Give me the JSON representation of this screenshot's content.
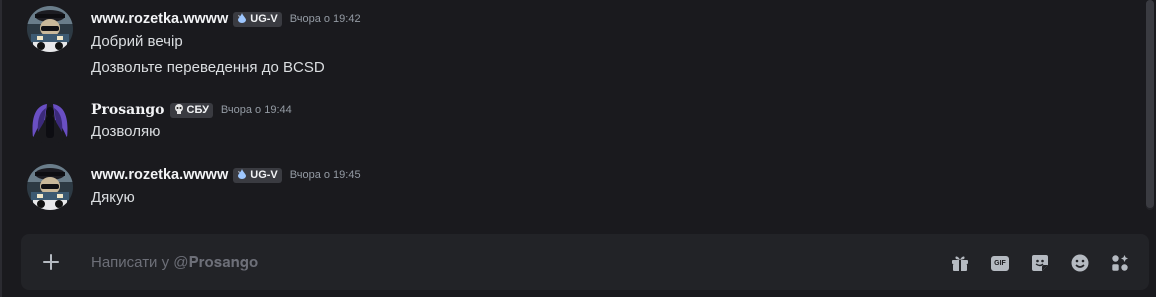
{
  "messages": [
    {
      "username": "www.rozetka.wwww",
      "tag": "UG-V",
      "tag_icon": "droplet-icon",
      "timestamp": "Вчора о 19:42",
      "lines": [
        "Добрий вечір",
        "Дозвольте переведення до BCSD"
      ]
    },
    {
      "username": "𝐏𝐫𝐨𝐬𝐚𝐧𝐠𝐨",
      "tag": "СБУ",
      "tag_icon": "skull-icon",
      "timestamp": "Вчора о 19:44",
      "lines": [
        "Дозволяю"
      ]
    },
    {
      "username": "www.rozetka.wwww",
      "tag": "UG-V",
      "tag_icon": "droplet-icon",
      "timestamp": "Вчора о 19:45",
      "lines": [
        "Дякую"
      ]
    }
  ],
  "composer": {
    "placeholder": "Написати у @𝐏𝐫𝐨𝐬𝐚𝐧𝐠𝐨",
    "gif_label": "GIF",
    "tools": [
      "gift-icon",
      "gif-icon",
      "sticker-icon",
      "emoji-icon",
      "apps-icon"
    ]
  },
  "colors": {
    "background": "#1a1a1e",
    "composer_bg": "#222327",
    "tag_bg": "#3a3b41",
    "username": "#f2f3f5",
    "text": "#dbdee1",
    "timestamp": "#949ba4",
    "icon": "#b5bac1"
  }
}
